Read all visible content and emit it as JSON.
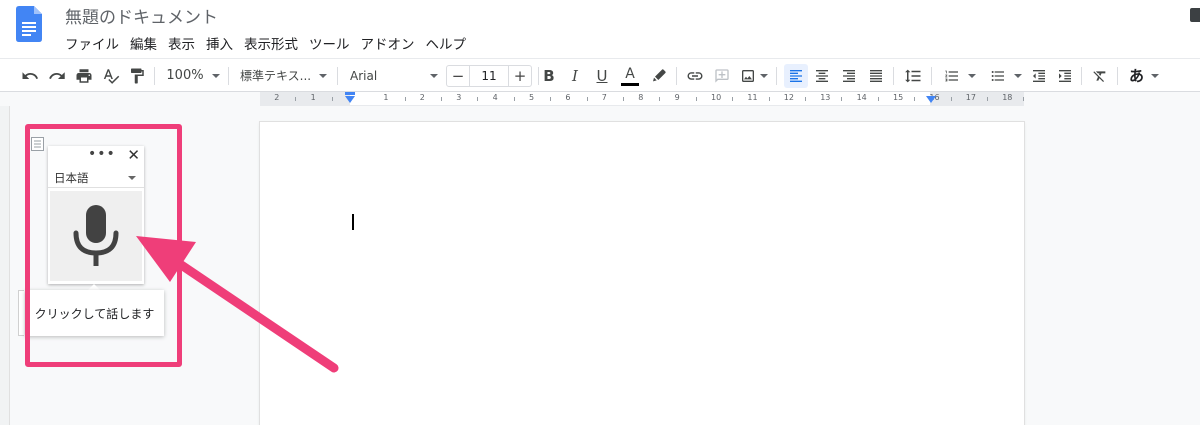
{
  "document": {
    "title": "無題のドキュメント"
  },
  "menu": [
    "ファイル",
    "編集",
    "表示",
    "挿入",
    "表示形式",
    "ツール",
    "アドオン",
    "ヘルプ"
  ],
  "toolbar": {
    "zoom": "100%",
    "style": "標準テキス...",
    "font": "Arial",
    "font_size": "11",
    "minus": "−",
    "plus": "+",
    "bold": "B",
    "italic": "I",
    "underline": "U",
    "text_color": "A",
    "input_tools": "あ"
  },
  "ruler": {
    "labels": [
      "2",
      "1",
      "1",
      "2",
      "3",
      "4",
      "5",
      "6",
      "7",
      "8",
      "9",
      "10",
      "11",
      "12",
      "13",
      "14",
      "15",
      "16",
      "17",
      "18"
    ]
  },
  "voice_typing": {
    "menu_dots": "•••",
    "close": "✕",
    "language": "日本語",
    "tooltip": "クリックして話します"
  },
  "colors": {
    "highlight": "#ef3e79",
    "accent": "#4285f4",
    "docs_blue": "#4285f4"
  },
  "icons": {
    "undo": "undo-icon",
    "redo": "redo-icon",
    "print": "print-icon",
    "spellcheck": "spellcheck-icon",
    "paint_format": "paint-format-icon",
    "microphone": "microphone-icon"
  }
}
